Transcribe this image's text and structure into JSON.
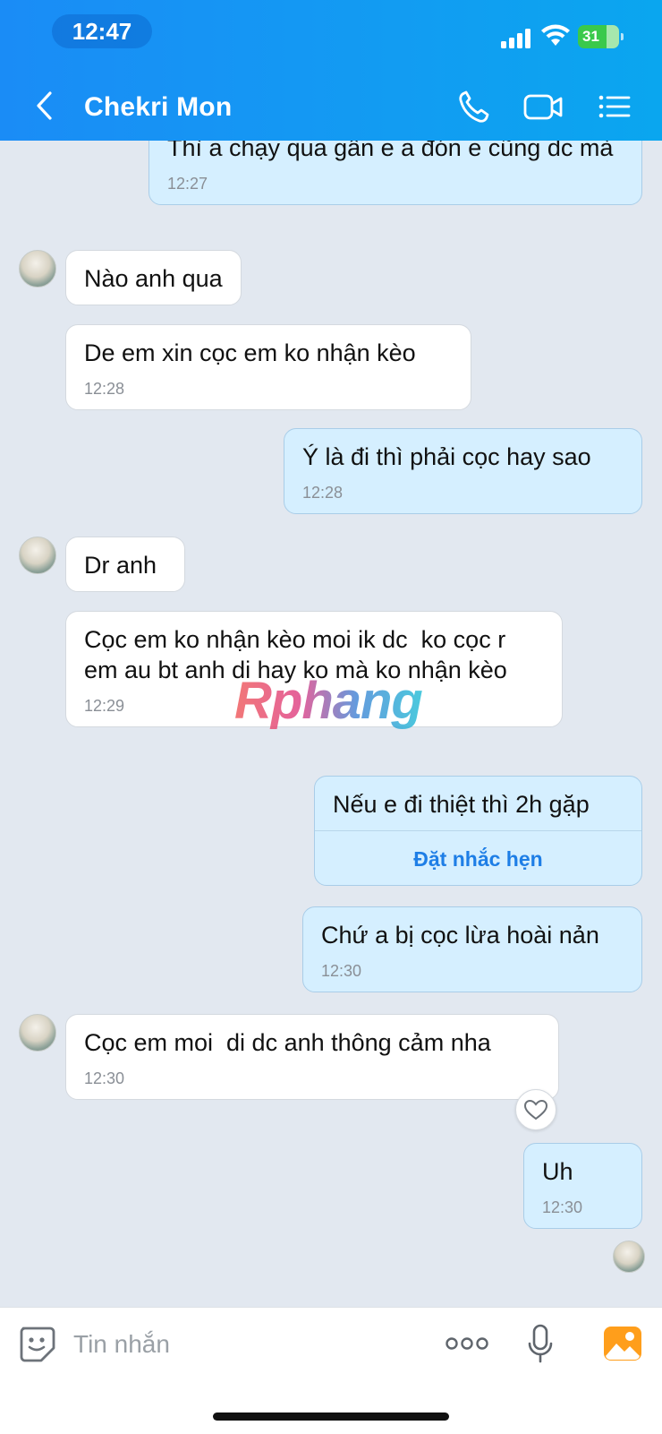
{
  "status_bar": {
    "time": "12:47",
    "battery": "31"
  },
  "header": {
    "contact_name": "Chekri Mon"
  },
  "watermark": "Rphang",
  "messages": [
    {
      "text": "Thì a chạy qua gần e a đón e cũng dc mà",
      "time": "12:27"
    },
    {
      "text": "Nào anh qua"
    },
    {
      "text": "De em xin cọc em ko nhận kèo",
      "time": "12:28"
    },
    {
      "text": "Ý là đi thì phải cọc hay sao",
      "time": "12:28"
    },
    {
      "text": "Dr anh"
    },
    {
      "text": "Cọc em ko nhận kèo moi ik dc  ko cọc r em au bt anh di hay ko mà ko nhận kèo",
      "time": "12:29"
    },
    {
      "text": "Nếu e đi thiệt thì 2h gặp",
      "action": "Đặt nhắc hẹn"
    },
    {
      "text": "Chứ a bị cọc lừa hoài nản",
      "time": "12:30"
    },
    {
      "text": "Cọc em moi  di dc anh thông cảm nha",
      "time": "12:30"
    },
    {
      "text": "Uh",
      "time": "12:30"
    }
  ],
  "input": {
    "placeholder": "Tin nhắn"
  },
  "colors": {
    "header": "#1a8cf6",
    "outgoing_bubble": "#d5efff",
    "incoming_bubble": "#ffffff",
    "chat_bg": "#e2e8f0"
  },
  "icons": [
    "back-icon",
    "phone-icon",
    "video-call-icon",
    "menu-list-icon",
    "sticker-icon",
    "more-dots-icon",
    "microphone-icon",
    "image-icon",
    "heart-icon"
  ]
}
